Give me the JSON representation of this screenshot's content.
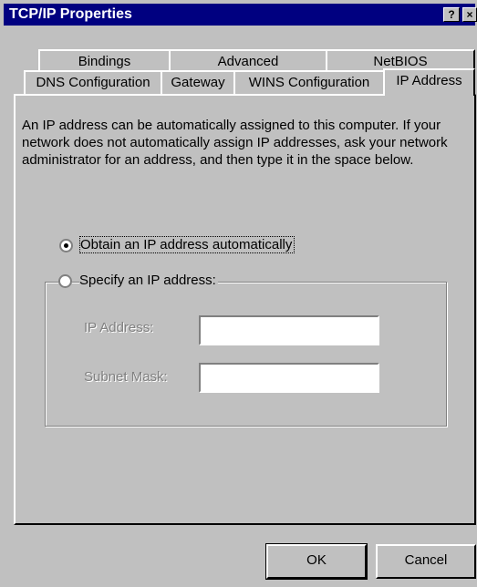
{
  "window": {
    "title": "TCP/IP Properties",
    "help_glyph": "?",
    "close_glyph": "×"
  },
  "tabs": {
    "back_row": [
      "Bindings",
      "Advanced",
      "NetBIOS"
    ],
    "front_row": [
      "DNS Configuration",
      "Gateway",
      "WINS Configuration",
      "IP Address"
    ],
    "active": "IP Address"
  },
  "content": {
    "description": "An IP address can be automatically assigned to this computer. If your network does not automatically assign IP addresses, ask your network administrator for an address, and then type it in the space below.",
    "obtain_automatically": {
      "label": "Obtain an IP address automatically",
      "selected": true
    },
    "specify_address": {
      "label": "Specify an IP address:",
      "selected": false
    },
    "ip_address": {
      "label": "IP Address:",
      "value": ""
    },
    "subnet_mask": {
      "label": "Subnet Mask:",
      "value": ""
    }
  },
  "buttons": {
    "ok": "OK",
    "cancel": "Cancel"
  },
  "colors": {
    "titlebar": "#000080",
    "face": "#c0c0c0",
    "disabled_text": "#808080"
  }
}
